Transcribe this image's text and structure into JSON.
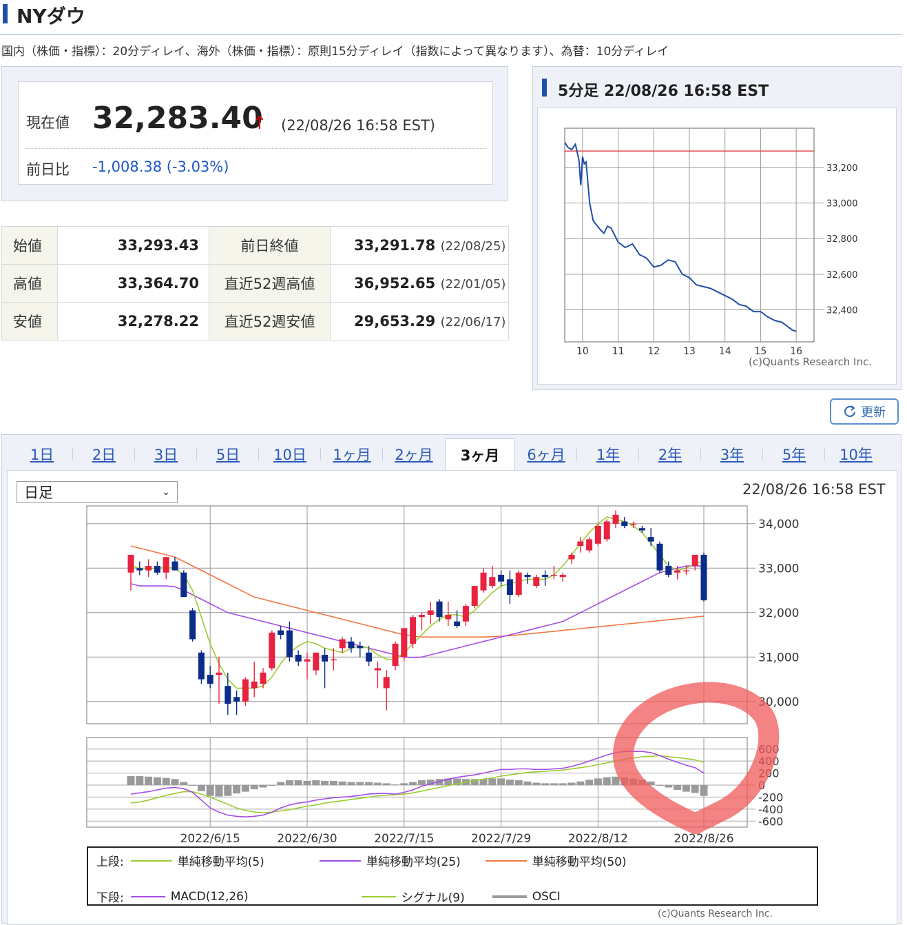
{
  "title": "NYダウ",
  "delay_note": "国内（株価・指標）：20分ディレイ、海外（株価・指標）：原則15分ディレイ（指数によって異なります）、為替：10分ディレイ",
  "current": {
    "label": "現在値",
    "value": "32,283.40",
    "arrow": "↑",
    "time": "(22/08/26 16:58 EST)",
    "change_label": "前日比",
    "change_value": "-1,008.38 (-3.03%)"
  },
  "price_table": [
    {
      "label": "始値",
      "value": "33,293.43",
      "label2": "前日終値",
      "value2": "33,291.78",
      "date2": "(22/08/25)"
    },
    {
      "label": "高値",
      "value": "33,364.70",
      "label2": "直近52週高値",
      "value2": "36,952.65",
      "date2": "(22/01/05)"
    },
    {
      "label": "安値",
      "value": "32,278.22",
      "label2": "直近52週安値",
      "value2": "29,653.29",
      "date2": "(22/06/17)"
    }
  ],
  "intraday": {
    "title": "5分足 22/08/26 16:58 EST",
    "copyright": "(c)Quants Research Inc.",
    "x_ticks": [
      "10",
      "11",
      "12",
      "13",
      "14",
      "15",
      "16"
    ],
    "y_ticks": [
      "33,200",
      "33,000",
      "32,800",
      "32,600",
      "32,400"
    ]
  },
  "refresh_label": "更新",
  "tabs": [
    "1日",
    "2日",
    "3日",
    "5日",
    "10日",
    "1ヶ月",
    "2ヶ月",
    "3ヶ月",
    "6ヶ月",
    "1年",
    "2年",
    "3年",
    "5年",
    "10年"
  ],
  "active_tab": "3ヶ月",
  "period_select": "日足",
  "chart_time": "22/08/26 16:58 EST",
  "chart_data": [
    {
      "type": "line",
      "x_unit": "hour (EST)",
      "x": [
        9.5,
        9.6,
        9.7,
        9.8,
        9.9,
        9.95,
        10.0,
        10.05,
        10.1,
        10.2,
        10.3,
        10.5,
        10.6,
        10.7,
        10.8,
        11.0,
        11.2,
        11.4,
        11.6,
        11.8,
        12.0,
        12.2,
        12.4,
        12.6,
        12.8,
        13.0,
        13.2,
        13.4,
        13.6,
        13.8,
        14.0,
        14.2,
        14.4,
        14.6,
        14.8,
        15.0,
        15.2,
        15.4,
        15.6,
        15.8,
        15.9,
        16.0
      ],
      "values": [
        33340,
        33310,
        33300,
        33330,
        33240,
        33100,
        33260,
        33220,
        33230,
        33000,
        32900,
        32850,
        32830,
        32870,
        32860,
        32780,
        32750,
        32770,
        32710,
        32690,
        32640,
        32650,
        32680,
        32670,
        32600,
        32580,
        32540,
        32530,
        32520,
        32500,
        32480,
        32460,
        32430,
        32420,
        32390,
        32390,
        32360,
        32340,
        32330,
        32300,
        32285,
        32280
      ],
      "previous_close": 33291.78,
      "ylim": [
        32220,
        33420
      ],
      "xlim": [
        9.5,
        16.5
      ]
    },
    {
      "type": "candlestick",
      "x_ticks": [
        "2022/6/15",
        "2022/6/30",
        "2022/7/15",
        "2022/7/29",
        "2022/8/12",
        "2022/8/26"
      ],
      "ylim": [
        29500,
        34400
      ],
      "y_ticks": [
        "34,000",
        "33,000",
        "32,000",
        "31,000",
        "30,000"
      ],
      "candles": [
        {
          "o": 32900,
          "h": 33000,
          "l": 32500,
          "c": 33300
        },
        {
          "o": 33000,
          "h": 33150,
          "l": 32850,
          "c": 32950
        },
        {
          "o": 32950,
          "h": 33200,
          "l": 32800,
          "c": 33050
        },
        {
          "o": 33050,
          "h": 33150,
          "l": 32850,
          "c": 32900
        },
        {
          "o": 32900,
          "h": 33150,
          "l": 32750,
          "c": 33250
        },
        {
          "o": 33150,
          "h": 33250,
          "l": 32950,
          "c": 32950
        },
        {
          "o": 32900,
          "h": 32950,
          "l": 32400,
          "c": 32350
        },
        {
          "o": 32050,
          "h": 32100,
          "l": 31350,
          "c": 31400
        },
        {
          "o": 31100,
          "h": 31150,
          "l": 30400,
          "c": 30500
        },
        {
          "o": 30600,
          "h": 30800,
          "l": 30300,
          "c": 30400
        },
        {
          "o": 30600,
          "h": 31000,
          "l": 29950,
          "c": 30650
        },
        {
          "o": 30350,
          "h": 30650,
          "l": 29700,
          "c": 29950
        },
        {
          "o": 30100,
          "h": 30250,
          "l": 29700,
          "c": 30000
        },
        {
          "o": 30000,
          "h": 30550,
          "l": 29900,
          "c": 30500
        },
        {
          "o": 30300,
          "h": 30900,
          "l": 30100,
          "c": 30450
        },
        {
          "o": 30400,
          "h": 30750,
          "l": 30300,
          "c": 30650
        },
        {
          "o": 30750,
          "h": 31600,
          "l": 30700,
          "c": 31550
        },
        {
          "o": 31600,
          "h": 31700,
          "l": 31400,
          "c": 31500
        },
        {
          "o": 31600,
          "h": 31800,
          "l": 30900,
          "c": 31000
        },
        {
          "o": 31050,
          "h": 31150,
          "l": 30800,
          "c": 30900
        },
        {
          "o": 30900,
          "h": 31100,
          "l": 30500,
          "c": 30950
        },
        {
          "o": 30700,
          "h": 31100,
          "l": 30600,
          "c": 31100
        },
        {
          "o": 31050,
          "h": 31200,
          "l": 30300,
          "c": 30900
        },
        {
          "o": 30950,
          "h": 31200,
          "l": 30700,
          "c": 30950
        },
        {
          "o": 31200,
          "h": 31450,
          "l": 31100,
          "c": 31400
        },
        {
          "o": 31350,
          "h": 31450,
          "l": 31100,
          "c": 31200
        },
        {
          "o": 31250,
          "h": 31350,
          "l": 31000,
          "c": 31200
        },
        {
          "o": 31100,
          "h": 31250,
          "l": 30800,
          "c": 30900
        },
        {
          "o": 30700,
          "h": 30900,
          "l": 30300,
          "c": 30750
        },
        {
          "o": 30300,
          "h": 30700,
          "l": 29800,
          "c": 30550
        },
        {
          "o": 30800,
          "h": 31350,
          "l": 30700,
          "c": 31300
        },
        {
          "o": 31000,
          "h": 31650,
          "l": 30900,
          "c": 31650
        },
        {
          "o": 31300,
          "h": 31950,
          "l": 31200,
          "c": 31900
        },
        {
          "o": 31900,
          "h": 32000,
          "l": 31600,
          "c": 31950
        },
        {
          "o": 31950,
          "h": 32250,
          "l": 31750,
          "c": 32050
        },
        {
          "o": 32250,
          "h": 32300,
          "l": 31800,
          "c": 31900
        },
        {
          "o": 31850,
          "h": 32250,
          "l": 31700,
          "c": 31950
        },
        {
          "o": 31800,
          "h": 32050,
          "l": 31650,
          "c": 31700
        },
        {
          "o": 31800,
          "h": 32200,
          "l": 31700,
          "c": 32150
        },
        {
          "o": 32150,
          "h": 32600,
          "l": 32100,
          "c": 32600
        },
        {
          "o": 32500,
          "h": 33000,
          "l": 32450,
          "c": 32900
        },
        {
          "o": 32600,
          "h": 33050,
          "l": 32550,
          "c": 32800
        },
        {
          "o": 32850,
          "h": 32950,
          "l": 32600,
          "c": 32700
        },
        {
          "o": 32750,
          "h": 32950,
          "l": 32200,
          "c": 32400
        },
        {
          "o": 32400,
          "h": 32950,
          "l": 32350,
          "c": 32900
        },
        {
          "o": 32850,
          "h": 32900,
          "l": 32650,
          "c": 32800
        },
        {
          "o": 32600,
          "h": 32850,
          "l": 32550,
          "c": 32800
        },
        {
          "o": 32850,
          "h": 32950,
          "l": 32600,
          "c": 32800
        },
        {
          "o": 32850,
          "h": 33050,
          "l": 32750,
          "c": 32850
        },
        {
          "o": 32800,
          "h": 32900,
          "l": 32700,
          "c": 32850
        },
        {
          "o": 33200,
          "h": 33350,
          "l": 33100,
          "c": 33300
        },
        {
          "o": 33500,
          "h": 33700,
          "l": 33350,
          "c": 33600
        },
        {
          "o": 33400,
          "h": 33700,
          "l": 33350,
          "c": 33650
        },
        {
          "o": 33550,
          "h": 34000,
          "l": 33500,
          "c": 33950
        },
        {
          "o": 33650,
          "h": 34100,
          "l": 33600,
          "c": 34050
        },
        {
          "o": 34000,
          "h": 34300,
          "l": 33900,
          "c": 34200
        },
        {
          "o": 34050,
          "h": 34150,
          "l": 33900,
          "c": 33950
        },
        {
          "o": 34000,
          "h": 34050,
          "l": 33900,
          "c": 34000
        },
        {
          "o": 33900,
          "h": 33950,
          "l": 33800,
          "c": 33850
        },
        {
          "o": 33700,
          "h": 33900,
          "l": 33500,
          "c": 33600
        },
        {
          "o": 33550,
          "h": 33600,
          "l": 32900,
          "c": 32950
        },
        {
          "o": 33050,
          "h": 33150,
          "l": 32800,
          "c": 32850
        },
        {
          "o": 32900,
          "h": 33050,
          "l": 32750,
          "c": 32950
        },
        {
          "o": 32950,
          "h": 33050,
          "l": 32850,
          "c": 32950
        },
        {
          "o": 33050,
          "h": 33300,
          "l": 32950,
          "c": 33300
        },
        {
          "o": 33300,
          "h": 33350,
          "l": 32250,
          "c": 32280
        }
      ],
      "sma5": [
        33050,
        33000,
        32990,
        33000,
        33010,
        33000,
        32850,
        32500,
        31900,
        31300,
        30850,
        30500,
        30300,
        30300,
        30300,
        30350,
        30550,
        30850,
        31100,
        31250,
        31350,
        31300,
        31200,
        31150,
        31100,
        31200,
        31250,
        31200,
        31050,
        30950,
        30950,
        31100,
        31300,
        31500,
        31700,
        31850,
        31950,
        31950,
        31900,
        32050,
        32250,
        32450,
        32600,
        32650,
        32700,
        32750,
        32750,
        32750,
        32850,
        33050,
        33300,
        33550,
        33800,
        34000,
        34150,
        34100,
        34050,
        33950,
        33800,
        33550,
        33300,
        33050,
        32950,
        33000,
        33100,
        33150
      ],
      "sma25": [
        32650,
        32600,
        32600,
        32600,
        32600,
        32580,
        32500,
        32400,
        32300,
        32200,
        32100,
        32000,
        31950,
        31900,
        31850,
        31800,
        31750,
        31700,
        31650,
        31600,
        31550,
        31500,
        31450,
        31400,
        31350,
        31300,
        31250,
        31200,
        31150,
        31100,
        31050,
        31000,
        30990,
        31000,
        31050,
        31100,
        31150,
        31200,
        31250,
        31300,
        31350,
        31400,
        31450,
        31500,
        31550,
        31600,
        31650,
        31700,
        31750,
        31800,
        31900,
        32000,
        32100,
        32200,
        32300,
        32400,
        32500,
        32600,
        32700,
        32800,
        32900,
        32950,
        33000,
        33050,
        33050,
        33050
      ],
      "sma50": [
        33500,
        33450,
        33400,
        33350,
        33300,
        33250,
        33150,
        33050,
        32950,
        32850,
        32750,
        32650,
        32550,
        32450,
        32350,
        32300,
        32250,
        32200,
        32150,
        32100,
        32050,
        32000,
        31950,
        31900,
        31850,
        31800,
        31750,
        31700,
        31650,
        31600,
        31550,
        31500,
        31480,
        31450,
        31450,
        31450,
        31450,
        31450,
        31450,
        31450,
        31450,
        31460,
        31470,
        31480,
        31500,
        31520,
        31540,
        31560,
        31580,
        31600,
        31620,
        31640,
        31660,
        31680,
        31700,
        31720,
        31740,
        31760,
        31780,
        31800,
        31820,
        31840,
        31860,
        31880,
        31900,
        31920
      ],
      "macd": [
        -150,
        -130,
        -110,
        -80,
        -50,
        -40,
        -60,
        -120,
        -250,
        -380,
        -450,
        -500,
        -520,
        -530,
        -520,
        -500,
        -450,
        -380,
        -330,
        -300,
        -280,
        -250,
        -230,
        -210,
        -200,
        -190,
        -170,
        -150,
        -140,
        -140,
        -150,
        -120,
        -80,
        -20,
        20,
        60,
        100,
        130,
        150,
        170,
        200,
        230,
        260,
        260,
        270,
        270,
        260,
        260,
        270,
        280,
        310,
        350,
        400,
        450,
        500,
        540,
        560,
        560,
        560,
        540,
        490,
        430,
        380,
        330,
        290,
        200
      ],
      "signal": [
        -300,
        -280,
        -250,
        -210,
        -170,
        -140,
        -110,
        -110,
        -150,
        -200,
        -260,
        -320,
        -380,
        -420,
        -450,
        -460,
        -450,
        -430,
        -410,
        -380,
        -350,
        -330,
        -300,
        -280,
        -260,
        -240,
        -220,
        -200,
        -180,
        -170,
        -160,
        -150,
        -130,
        -100,
        -70,
        -40,
        -10,
        20,
        50,
        70,
        100,
        120,
        150,
        170,
        190,
        210,
        220,
        230,
        240,
        250,
        270,
        290,
        310,
        340,
        370,
        400,
        430,
        450,
        470,
        480,
        490,
        470,
        460,
        440,
        420,
        380
      ],
      "osci": [
        150,
        150,
        140,
        130,
        120,
        100,
        50,
        -10,
        -100,
        -180,
        -190,
        -180,
        -140,
        -110,
        -70,
        -40,
        0,
        50,
        80,
        80,
        70,
        80,
        70,
        70,
        60,
        50,
        50,
        50,
        40,
        30,
        10,
        30,
        50,
        80,
        90,
        100,
        110,
        110,
        100,
        100,
        100,
        110,
        110,
        90,
        80,
        60,
        40,
        30,
        30,
        30,
        40,
        60,
        90,
        110,
        130,
        140,
        130,
        110,
        90,
        60,
        0,
        -40,
        -80,
        -110,
        -130,
        -180
      ]
    }
  ],
  "macd_y_ticks": [
    "600",
    "400",
    "200",
    "0",
    "-200",
    "-400",
    "-600"
  ],
  "legend": {
    "upper_label": "上段:",
    "upper": [
      "単純移動平均(5)",
      "単純移動平均(25)",
      "単純移動平均(50)"
    ],
    "lower_label": "下段:",
    "lower": [
      "MACD(12,26)",
      "シグナル(9)",
      "OSCI"
    ]
  },
  "colors": {
    "accent_blue": "#1f4fa8",
    "up_candle": "#e8233f",
    "down_candle": "#0b2c8a",
    "sma5": "#9acd32",
    "sma25": "#a64ce8",
    "sma50": "#f07840",
    "osci": "#9a9a9a",
    "intraday_line": "#1f4fa8",
    "prev_close_line": "#e05050",
    "highlight_circle": "#f05a5a"
  },
  "copyright_bottom": "(c)Quants Research Inc."
}
